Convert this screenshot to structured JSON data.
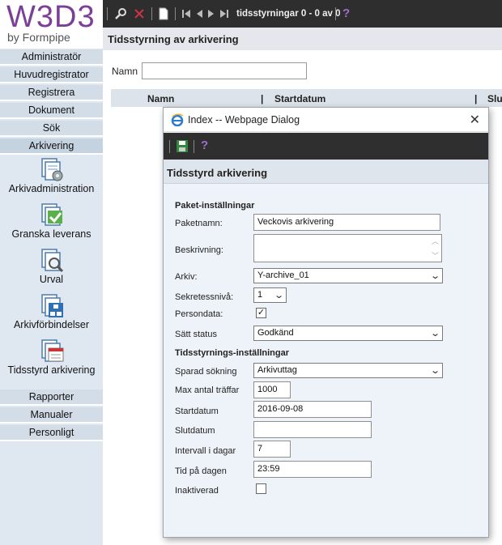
{
  "brand": {
    "logo": "W3D3",
    "byline": "by Formpipe"
  },
  "sidebar": {
    "top_items": [
      "Administratör",
      "Huvudregistrator",
      "Registrera",
      "Dokument",
      "Sök",
      "Arkivering"
    ],
    "archive_items": [
      "Arkivadministration",
      "Granska leverans",
      "Urval",
      "Arkivförbindelser",
      "Tidsstyrd arkivering"
    ],
    "bottom_items": [
      "Rapporter",
      "Manualer",
      "Personligt"
    ]
  },
  "toolbar": {
    "nav_text": "tidsstyrningar 0 - 0 av 0"
  },
  "page": {
    "title": "Tidsstyrning av arkivering",
    "namn_label": "Namn",
    "namn_value": "",
    "columns": [
      "Namn",
      "Startdatum",
      "Slut"
    ]
  },
  "dialog": {
    "window_title": "Index -- Webpage Dialog",
    "heading": "Tidsstyrd arkivering",
    "section1": "Paket-inställningar",
    "section2": "Tidsstyrnings-inställningar",
    "fields": {
      "paketnamn_label": "Paketnamn:",
      "paketnamn_value": "Veckovis arkivering",
      "beskrivning_label": "Beskrivning:",
      "beskrivning_value": "",
      "arkiv_label": "Arkiv:",
      "arkiv_value": "Y-archive_01",
      "sekretess_label": "Sekretessnivå:",
      "sekretess_value": "1",
      "persondata_label": "Persondata:",
      "persondata_checked": true,
      "status_label": "Sätt status",
      "status_value": "Godkänd",
      "sparad_label": "Sparad sökning",
      "sparad_value": "Arkivuttag",
      "max_label": "Max antal träffar",
      "max_value": "1000",
      "start_label": "Startdatum",
      "start_value": "2016-09-08",
      "slut_label": "Slutdatum",
      "slut_value": "",
      "intervall_label": "Intervall i dagar",
      "intervall_value": "7",
      "tid_label": "Tid på dagen",
      "tid_value": "23:59",
      "inaktiverad_label": "Inaktiverad",
      "inaktiverad_checked": false
    }
  },
  "colors": {
    "brand": "#7b3f98",
    "toolbar": "#2e2e2e",
    "sidebar": "#dfe8f1",
    "help": "#a070c8"
  }
}
